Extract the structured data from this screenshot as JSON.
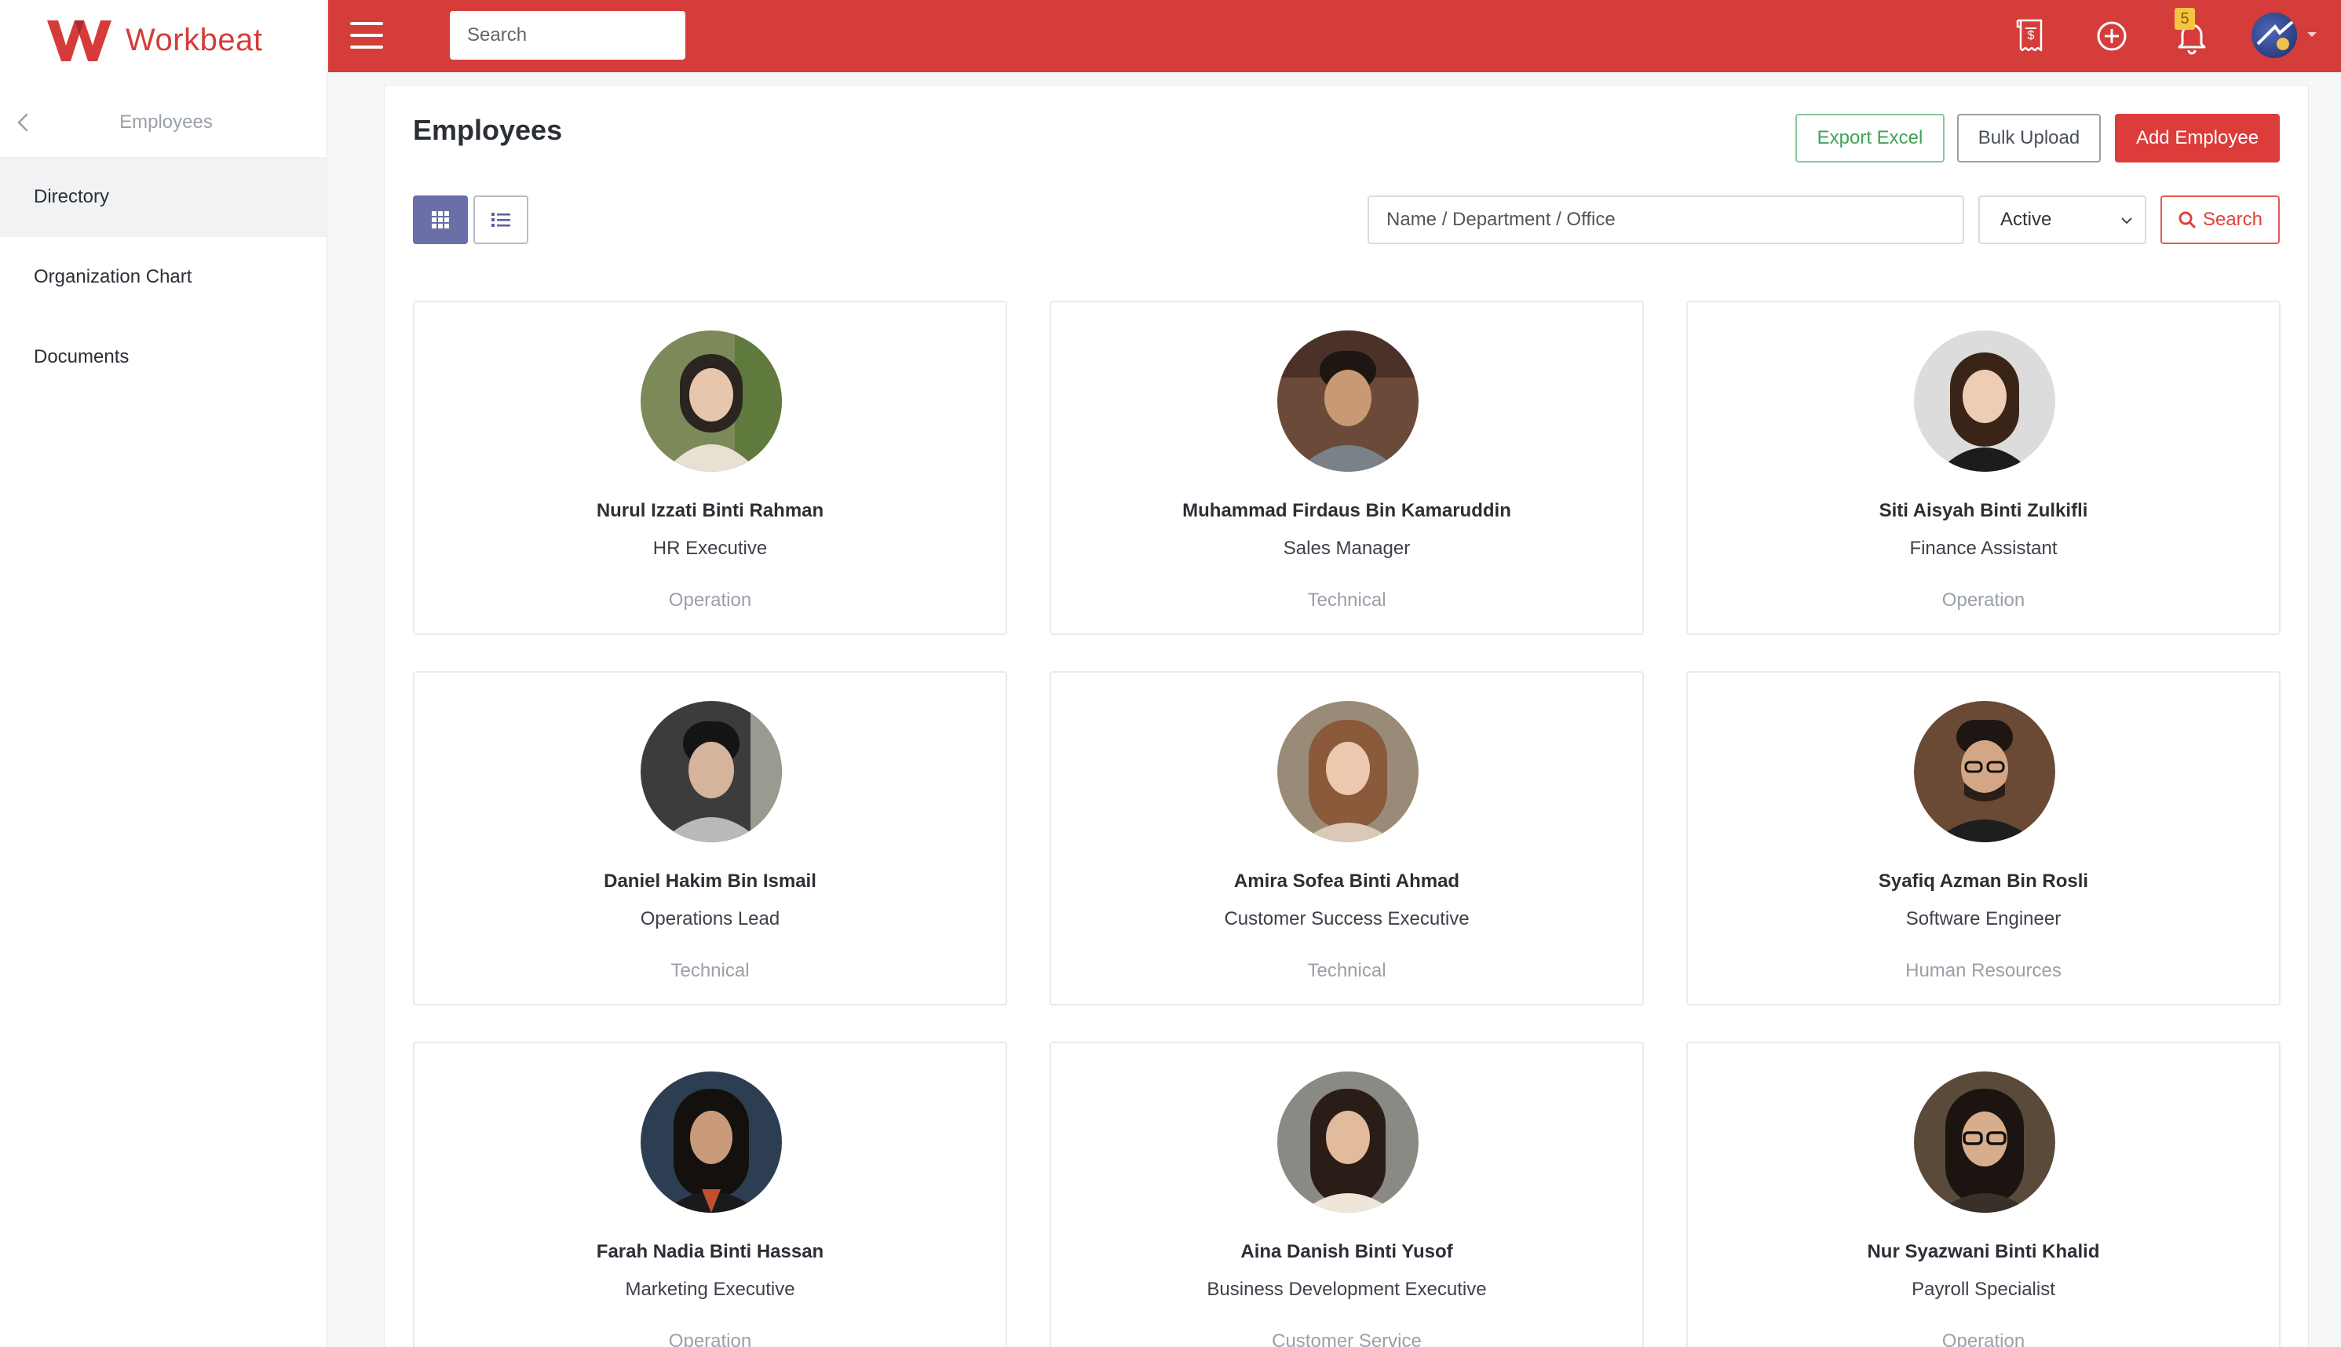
{
  "brand": {
    "name": "Workbeat",
    "color": "#d63b3b"
  },
  "sidebar": {
    "back_label": "Employees",
    "items": [
      {
        "label": "Directory",
        "active": true
      },
      {
        "label": "Organization Chart",
        "active": false
      },
      {
        "label": "Documents",
        "active": false
      }
    ]
  },
  "topbar": {
    "search_placeholder": "Search",
    "icons": [
      "invoice-icon",
      "add-circle-icon",
      "bell-icon",
      "user-avatar"
    ],
    "notification_count": "5",
    "color": "#d43d3a"
  },
  "page": {
    "title": "Employees",
    "buttons": {
      "export": "Export Excel",
      "bulk": "Bulk Upload",
      "add": "Add Employee"
    },
    "view_modes": {
      "selected": "grid",
      "icons": [
        "grid-view-icon",
        "list-view-icon"
      ]
    },
    "filter_placeholder": "Name / Department / Office",
    "status_value": "Active",
    "search_label": "Search"
  },
  "employees": [
    {
      "name": "Nurul Izzati Binti Rahman",
      "title": "HR Executive",
      "dept": "Operation"
    },
    {
      "name": "Muhammad Firdaus Bin Kamaruddin",
      "title": "Sales Manager",
      "dept": "Technical"
    },
    {
      "name": "Siti Aisyah Binti Zulkifli",
      "title": "Finance Assistant",
      "dept": "Operation"
    },
    {
      "name": "Daniel Hakim Bin Ismail",
      "title": "Operations Lead",
      "dept": "Technical"
    },
    {
      "name": "Amira Sofea Binti Ahmad",
      "title": "Customer Success Executive",
      "dept": "Technical"
    },
    {
      "name": "Syafiq Azman Bin Rosli",
      "title": "Software Engineer",
      "dept": "Human Resources"
    },
    {
      "name": "Farah Nadia Binti Hassan",
      "title": "Marketing Executive",
      "dept": "Operation"
    },
    {
      "name": "Aina Danish Binti Yusof",
      "title": "Business Development Executive",
      "dept": "Customer Service"
    },
    {
      "name": "Nur Syazwani Binti Khalid",
      "title": "Payroll Specialist",
      "dept": "Operation"
    }
  ]
}
